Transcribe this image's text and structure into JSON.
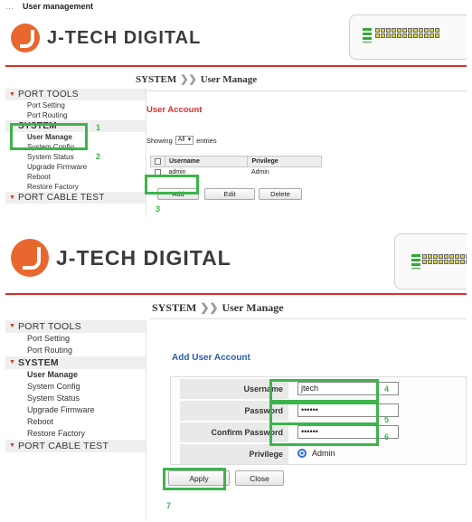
{
  "doc_title": "User management",
  "brand": {
    "name": "J-TECH DIGITAL"
  },
  "colors": {
    "accent": "#d9312b",
    "highlight": "#3cb44b",
    "form_title": "#2a5fa8",
    "logo": "#e8672e"
  },
  "breadcrumb": {
    "section": "SYSTEM",
    "separator": "❯❯",
    "page": "User Manage"
  },
  "sidebar": {
    "port_tools": "PORT TOOLS",
    "port_setting": "Port Setting",
    "port_routing": "Port Routing",
    "system": "SYSTEM",
    "user_manage": "User Manage",
    "system_config": "System Config",
    "system_status": "System Status",
    "upgrade_firmware": "Upgrade Firmware",
    "reboot": "Reboot",
    "restore_factory": "Restore Factory",
    "port_cable_test": "PORT CABLE TEST"
  },
  "user_account": {
    "title": "User Account",
    "showing_prefix": "Showing",
    "showing_value": "All",
    "showing_suffix": "entries",
    "columns": {
      "username": "Username",
      "privilege": "Privilege"
    },
    "rows": [
      {
        "username": "admin",
        "privilege": "Admin"
      }
    ],
    "buttons": {
      "add": "Add",
      "edit": "Edit",
      "delete": "Delete"
    }
  },
  "add_user": {
    "title": "Add User Account",
    "username_label": "Username",
    "username_value": "jtech",
    "password_label": "Password",
    "password_value": "••••••",
    "confirm_label": "Confirm Password",
    "confirm_value": "••••••",
    "privilege_label": "Privilege",
    "privilege_value": "Admin",
    "apply": "Apply",
    "close": "Close"
  },
  "steps": {
    "s1": "1",
    "s2": "2",
    "s3": "3",
    "s4": "4",
    "s5": "5",
    "s6": "6",
    "s7": "7"
  },
  "icons": [
    "logo-icon",
    "switch-device-icon",
    "chevron-down-icon",
    "chevron-right-icon",
    "checkbox-icon",
    "radio-icon"
  ]
}
